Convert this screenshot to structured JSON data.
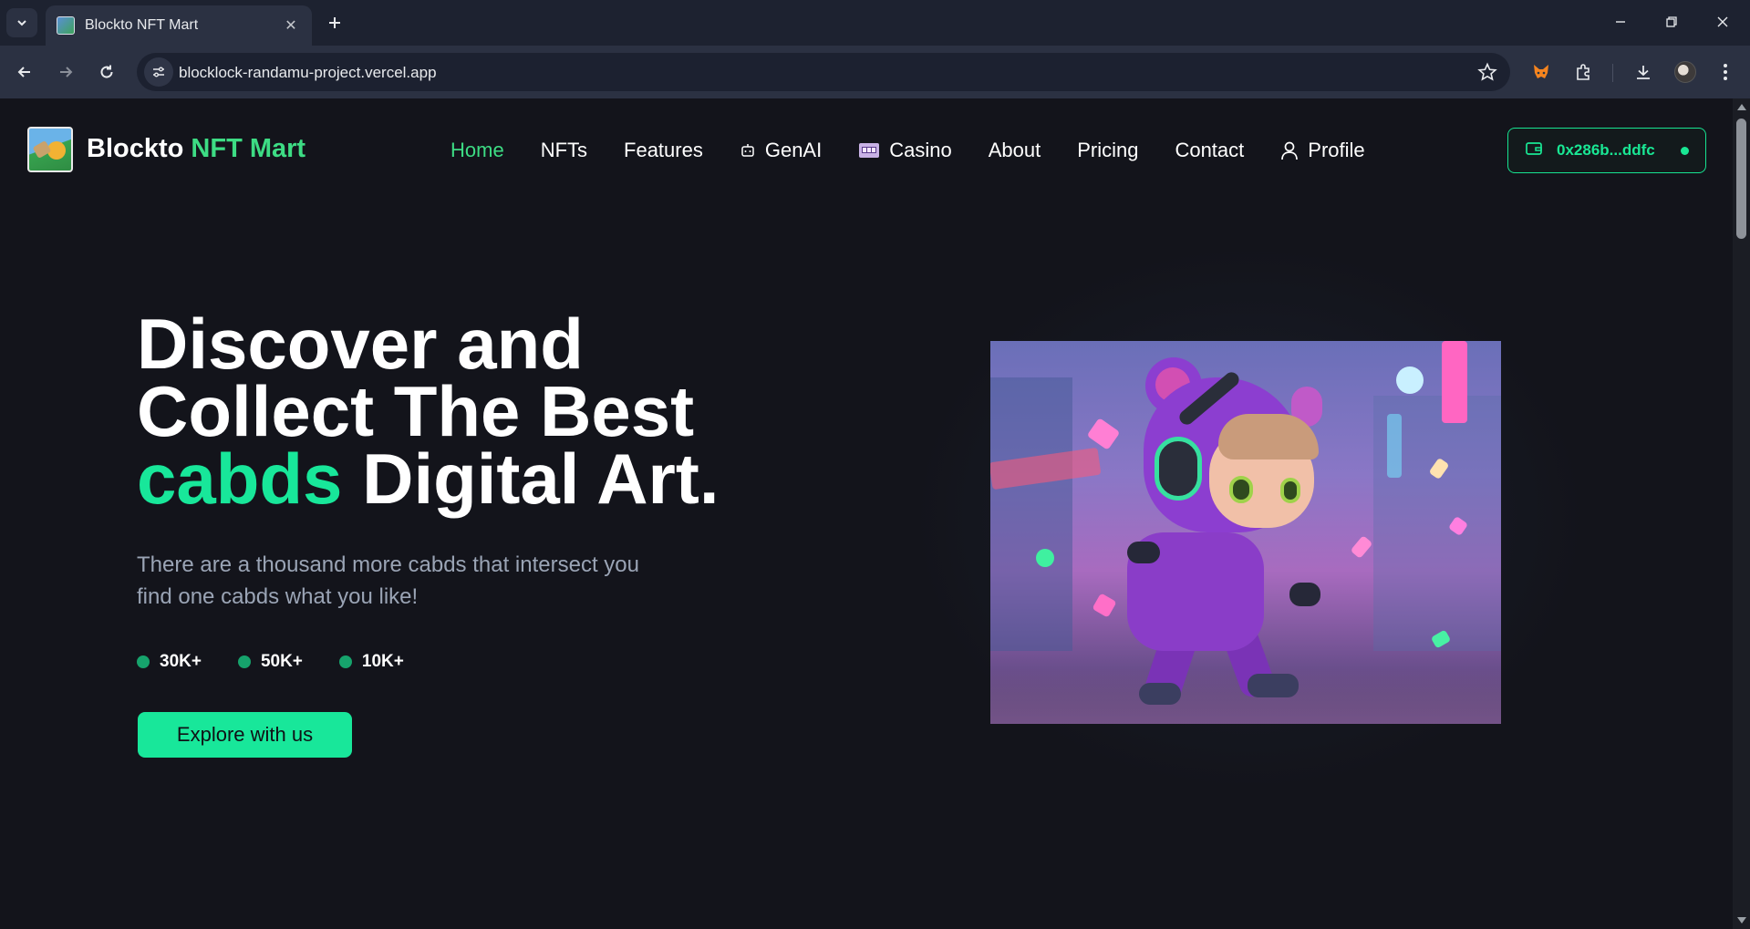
{
  "browser": {
    "tab_title": "Blockto NFT Mart",
    "url": "blocklock-randamu-project.vercel.app"
  },
  "site": {
    "brand_main": "Blockto",
    "brand_accent": "NFT Mart",
    "nav": [
      {
        "label": "Home",
        "active": true
      },
      {
        "label": "NFTs"
      },
      {
        "label": "Features"
      },
      {
        "label": "GenAI",
        "icon": "robot-icon"
      },
      {
        "label": "Casino",
        "icon": "slot-machine-icon"
      },
      {
        "label": "About"
      },
      {
        "label": "Pricing"
      },
      {
        "label": "Contact"
      },
      {
        "label": "Profile",
        "icon": "user-icon"
      }
    ],
    "wallet": {
      "address": "0x286b...ddfc",
      "icon": "wallet-icon"
    }
  },
  "hero": {
    "title_line1": "Discover and",
    "title_line2": "Collect The Best",
    "title_accent": "cabds",
    "title_line3_rest": "Digital Art.",
    "subtitle": "There are a thousand more cabds that intersect you find one cabds what you like!",
    "stats": [
      "30K+",
      "50K+",
      "10K+"
    ],
    "cta": "Explore with us"
  },
  "colors": {
    "accent": "#18e79a",
    "brand_accent": "#3ddc84",
    "page_bg": "#13141b"
  }
}
